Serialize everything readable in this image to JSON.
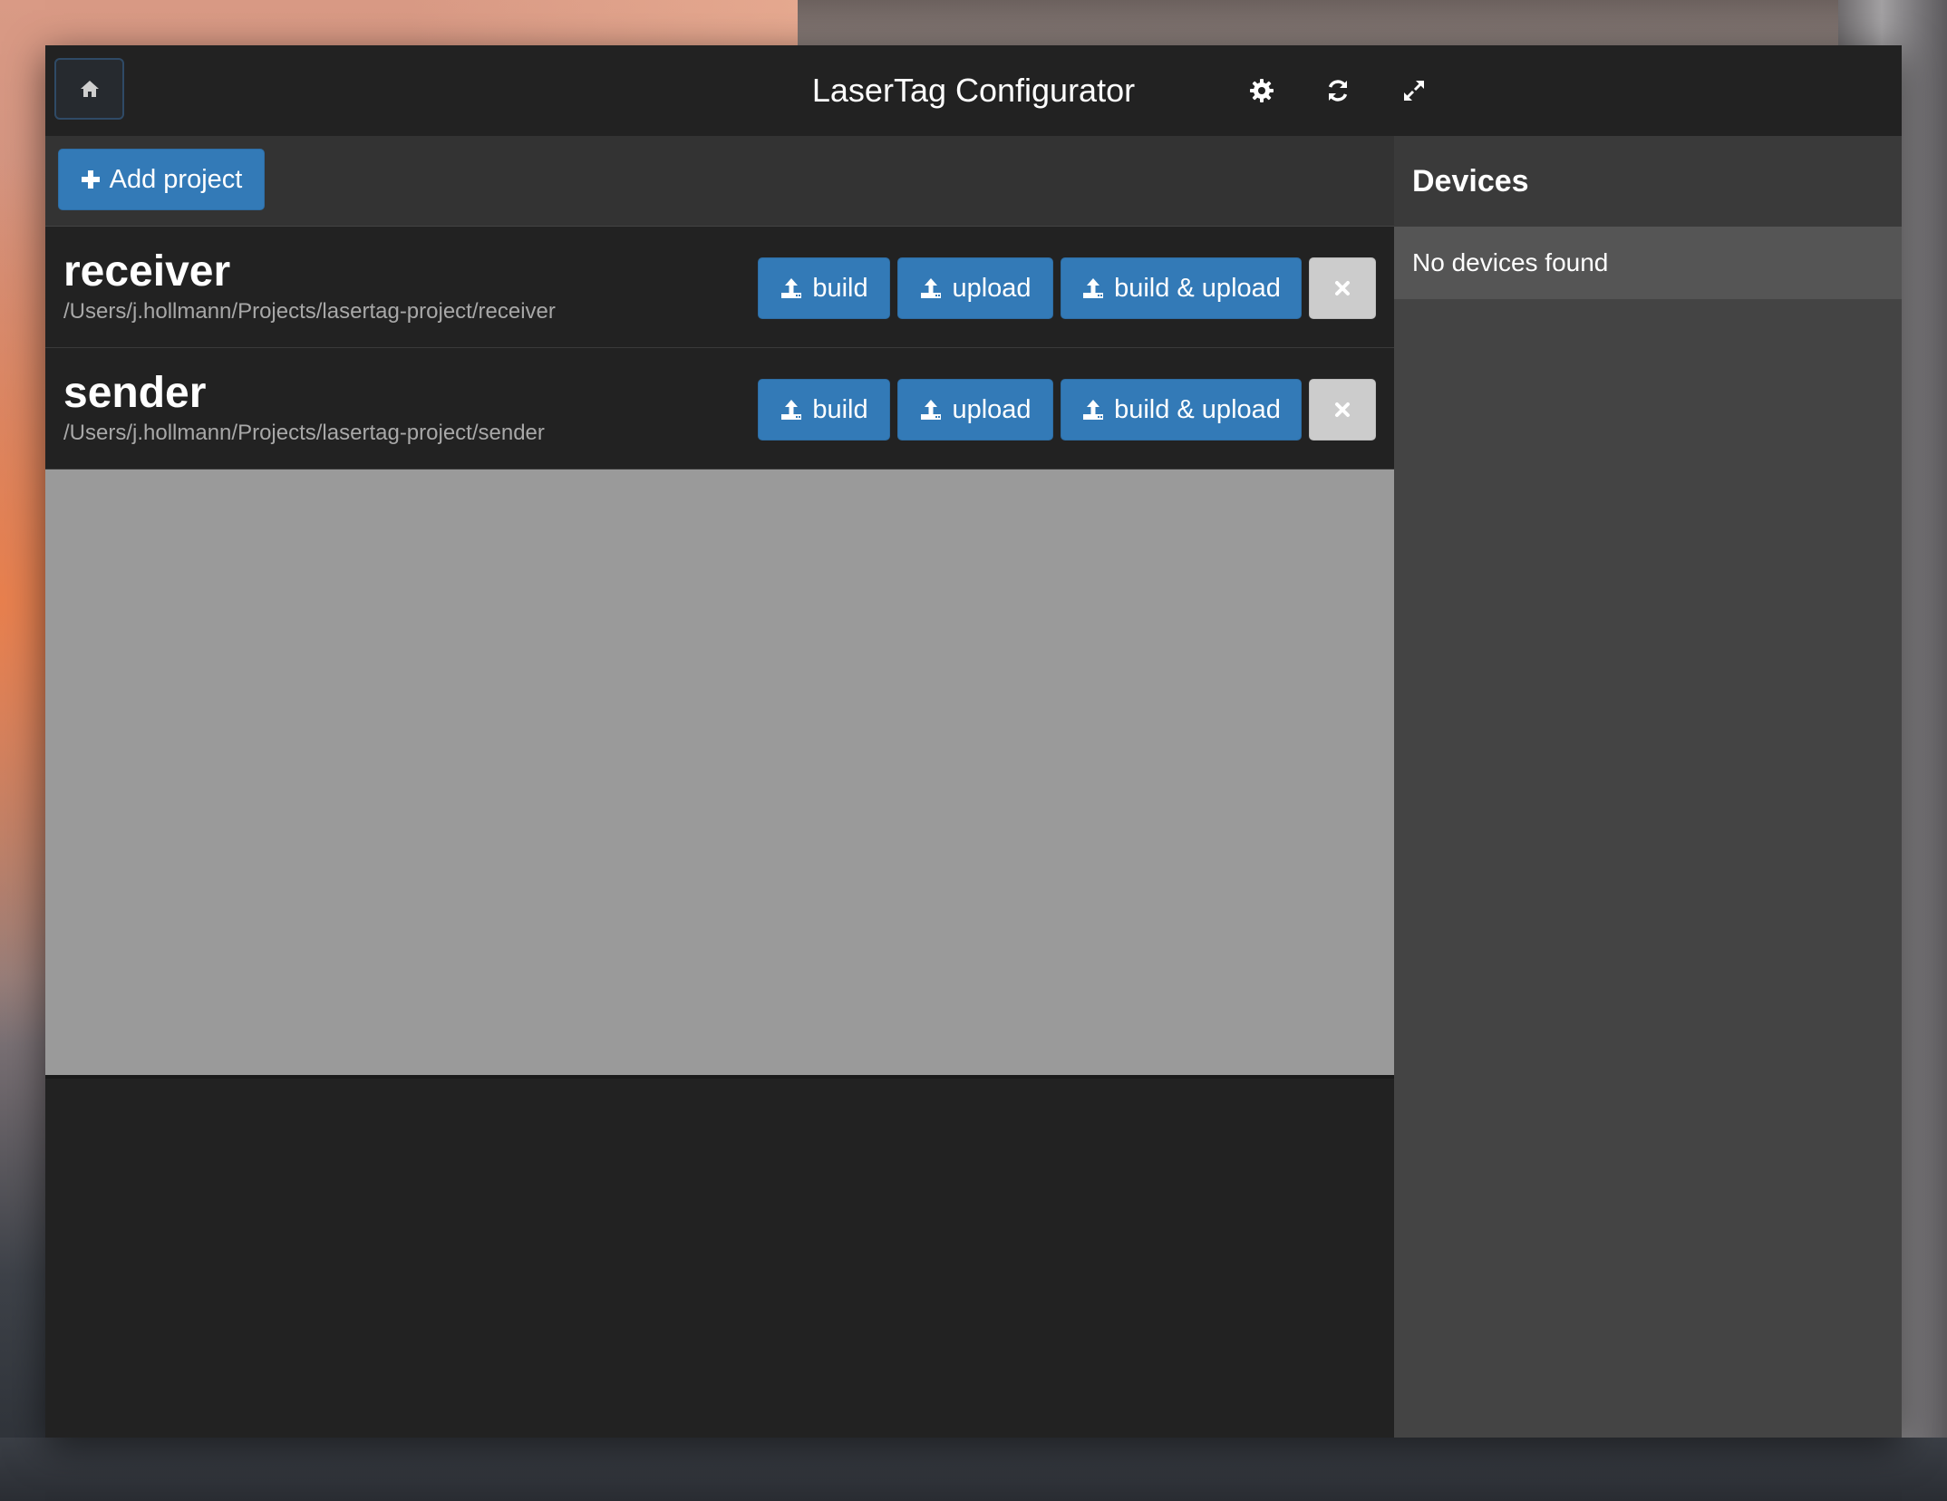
{
  "app": {
    "title": "LaserTag Configurator",
    "icons": {
      "home": "home-icon",
      "settings": "gear-icon",
      "refresh": "refresh-icon",
      "fullscreen": "expand-icon"
    }
  },
  "toolbar": {
    "add_project_label": "Add project",
    "add_icon": "plus-icon"
  },
  "projects": [
    {
      "name": "receiver",
      "path": "/Users/j.hollmann/Projects/lasertag-project/receiver",
      "actions": {
        "build": "build",
        "upload": "upload",
        "build_upload": "build & upload"
      }
    },
    {
      "name": "sender",
      "path": "/Users/j.hollmann/Projects/lasertag-project/sender",
      "actions": {
        "build": "build",
        "upload": "upload",
        "build_upload": "build & upload"
      }
    }
  ],
  "devices": {
    "title": "Devices",
    "empty_message": "No devices found"
  },
  "colors": {
    "primary": "#337ab7",
    "remove_button": "#cccccc",
    "window_bg": "#222222",
    "sidebar_bg": "#444444",
    "empty_area": "#9a9a9a"
  }
}
